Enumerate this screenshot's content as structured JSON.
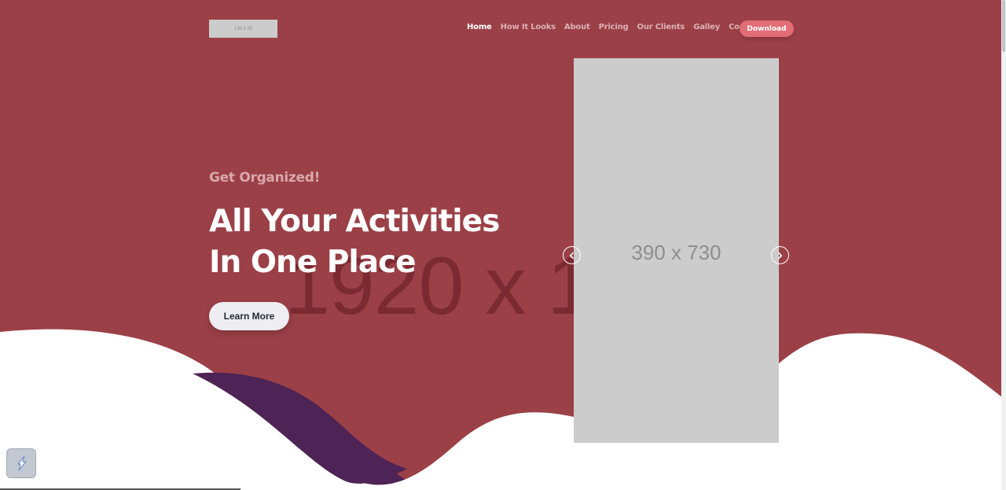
{
  "brand": {
    "logo_placeholder": "130 x 35"
  },
  "nav": {
    "items": [
      {
        "label": "Home",
        "active": true
      },
      {
        "label": "How It Looks",
        "active": false
      },
      {
        "label": "About",
        "active": false
      },
      {
        "label": "Pricing",
        "active": false
      },
      {
        "label": "Our Clients",
        "active": false
      },
      {
        "label": "Galley",
        "active": false
      },
      {
        "label": "Contact",
        "active": false
      }
    ],
    "download_label": "Download"
  },
  "hero": {
    "kicker": "Get Organized!",
    "headline_line1": "All Your Activities",
    "headline_line2": "In One Place",
    "cta_label": "Learn More",
    "background_placeholder": "1920 x 1",
    "phone_placeholder": "390 x 730"
  },
  "carousel": {
    "prev_icon": "chevron-left-icon",
    "next_icon": "chevron-right-icon"
  },
  "widget": {
    "icon": "lightning-icon"
  },
  "colors": {
    "background": "#9b4047",
    "accent": "#e16d76",
    "wave_purple": "#4e2355",
    "placeholder_gray": "#cccccc"
  }
}
